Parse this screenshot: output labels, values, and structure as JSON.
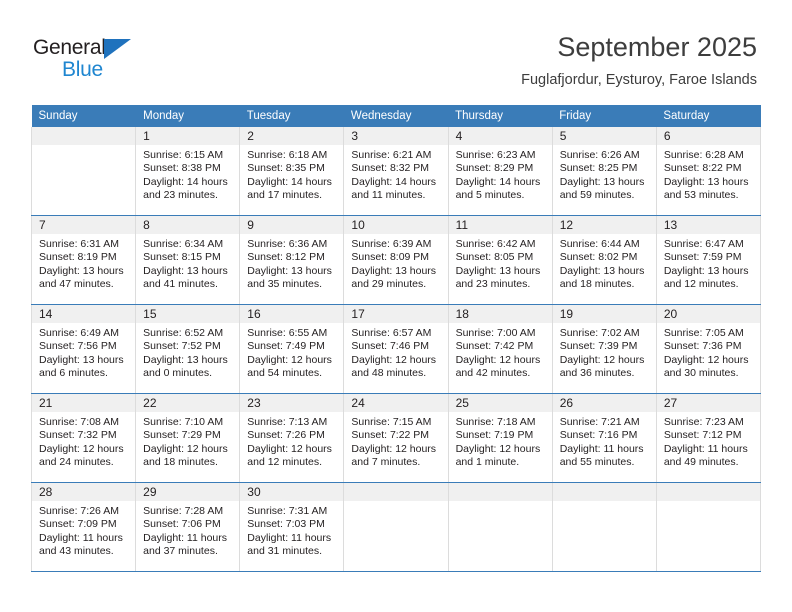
{
  "brand": {
    "name_top": "General",
    "name_bottom": "Blue",
    "accent_color": "#1f86d0",
    "triangle_color": "#1f72bd"
  },
  "header": {
    "title": "September 2025",
    "subtitle": "Fuglafjordur, Eysturoy, Faroe Islands"
  },
  "theme": {
    "header_row_bg": "#3a7cb8",
    "daynum_band_bg": "#f0f0f0",
    "cell_border": "#dcdcdc",
    "week_divider": "#3a7cb8",
    "text": "#231f20"
  },
  "weekday_headers": [
    "Sunday",
    "Monday",
    "Tuesday",
    "Wednesday",
    "Thursday",
    "Friday",
    "Saturday"
  ],
  "weeks": [
    [
      {
        "day": "",
        "sunrise": "",
        "sunset": "",
        "daylight": ""
      },
      {
        "day": "1",
        "sunrise": "Sunrise: 6:15 AM",
        "sunset": "Sunset: 8:38 PM",
        "daylight": "Daylight: 14 hours and 23 minutes."
      },
      {
        "day": "2",
        "sunrise": "Sunrise: 6:18 AM",
        "sunset": "Sunset: 8:35 PM",
        "daylight": "Daylight: 14 hours and 17 minutes."
      },
      {
        "day": "3",
        "sunrise": "Sunrise: 6:21 AM",
        "sunset": "Sunset: 8:32 PM",
        "daylight": "Daylight: 14 hours and 11 minutes."
      },
      {
        "day": "4",
        "sunrise": "Sunrise: 6:23 AM",
        "sunset": "Sunset: 8:29 PM",
        "daylight": "Daylight: 14 hours and 5 minutes."
      },
      {
        "day": "5",
        "sunrise": "Sunrise: 6:26 AM",
        "sunset": "Sunset: 8:25 PM",
        "daylight": "Daylight: 13 hours and 59 minutes."
      },
      {
        "day": "6",
        "sunrise": "Sunrise: 6:28 AM",
        "sunset": "Sunset: 8:22 PM",
        "daylight": "Daylight: 13 hours and 53 minutes."
      }
    ],
    [
      {
        "day": "7",
        "sunrise": "Sunrise: 6:31 AM",
        "sunset": "Sunset: 8:19 PM",
        "daylight": "Daylight: 13 hours and 47 minutes."
      },
      {
        "day": "8",
        "sunrise": "Sunrise: 6:34 AM",
        "sunset": "Sunset: 8:15 PM",
        "daylight": "Daylight: 13 hours and 41 minutes."
      },
      {
        "day": "9",
        "sunrise": "Sunrise: 6:36 AM",
        "sunset": "Sunset: 8:12 PM",
        "daylight": "Daylight: 13 hours and 35 minutes."
      },
      {
        "day": "10",
        "sunrise": "Sunrise: 6:39 AM",
        "sunset": "Sunset: 8:09 PM",
        "daylight": "Daylight: 13 hours and 29 minutes."
      },
      {
        "day": "11",
        "sunrise": "Sunrise: 6:42 AM",
        "sunset": "Sunset: 8:05 PM",
        "daylight": "Daylight: 13 hours and 23 minutes."
      },
      {
        "day": "12",
        "sunrise": "Sunrise: 6:44 AM",
        "sunset": "Sunset: 8:02 PM",
        "daylight": "Daylight: 13 hours and 18 minutes."
      },
      {
        "day": "13",
        "sunrise": "Sunrise: 6:47 AM",
        "sunset": "Sunset: 7:59 PM",
        "daylight": "Daylight: 13 hours and 12 minutes."
      }
    ],
    [
      {
        "day": "14",
        "sunrise": "Sunrise: 6:49 AM",
        "sunset": "Sunset: 7:56 PM",
        "daylight": "Daylight: 13 hours and 6 minutes."
      },
      {
        "day": "15",
        "sunrise": "Sunrise: 6:52 AM",
        "sunset": "Sunset: 7:52 PM",
        "daylight": "Daylight: 13 hours and 0 minutes."
      },
      {
        "day": "16",
        "sunrise": "Sunrise: 6:55 AM",
        "sunset": "Sunset: 7:49 PM",
        "daylight": "Daylight: 12 hours and 54 minutes."
      },
      {
        "day": "17",
        "sunrise": "Sunrise: 6:57 AM",
        "sunset": "Sunset: 7:46 PM",
        "daylight": "Daylight: 12 hours and 48 minutes."
      },
      {
        "day": "18",
        "sunrise": "Sunrise: 7:00 AM",
        "sunset": "Sunset: 7:42 PM",
        "daylight": "Daylight: 12 hours and 42 minutes."
      },
      {
        "day": "19",
        "sunrise": "Sunrise: 7:02 AM",
        "sunset": "Sunset: 7:39 PM",
        "daylight": "Daylight: 12 hours and 36 minutes."
      },
      {
        "day": "20",
        "sunrise": "Sunrise: 7:05 AM",
        "sunset": "Sunset: 7:36 PM",
        "daylight": "Daylight: 12 hours and 30 minutes."
      }
    ],
    [
      {
        "day": "21",
        "sunrise": "Sunrise: 7:08 AM",
        "sunset": "Sunset: 7:32 PM",
        "daylight": "Daylight: 12 hours and 24 minutes."
      },
      {
        "day": "22",
        "sunrise": "Sunrise: 7:10 AM",
        "sunset": "Sunset: 7:29 PM",
        "daylight": "Daylight: 12 hours and 18 minutes."
      },
      {
        "day": "23",
        "sunrise": "Sunrise: 7:13 AM",
        "sunset": "Sunset: 7:26 PM",
        "daylight": "Daylight: 12 hours and 12 minutes."
      },
      {
        "day": "24",
        "sunrise": "Sunrise: 7:15 AM",
        "sunset": "Sunset: 7:22 PM",
        "daylight": "Daylight: 12 hours and 7 minutes."
      },
      {
        "day": "25",
        "sunrise": "Sunrise: 7:18 AM",
        "sunset": "Sunset: 7:19 PM",
        "daylight": "Daylight: 12 hours and 1 minute."
      },
      {
        "day": "26",
        "sunrise": "Sunrise: 7:21 AM",
        "sunset": "Sunset: 7:16 PM",
        "daylight": "Daylight: 11 hours and 55 minutes."
      },
      {
        "day": "27",
        "sunrise": "Sunrise: 7:23 AM",
        "sunset": "Sunset: 7:12 PM",
        "daylight": "Daylight: 11 hours and 49 minutes."
      }
    ],
    [
      {
        "day": "28",
        "sunrise": "Sunrise: 7:26 AM",
        "sunset": "Sunset: 7:09 PM",
        "daylight": "Daylight: 11 hours and 43 minutes."
      },
      {
        "day": "29",
        "sunrise": "Sunrise: 7:28 AM",
        "sunset": "Sunset: 7:06 PM",
        "daylight": "Daylight: 11 hours and 37 minutes."
      },
      {
        "day": "30",
        "sunrise": "Sunrise: 7:31 AM",
        "sunset": "Sunset: 7:03 PM",
        "daylight": "Daylight: 11 hours and 31 minutes."
      },
      {
        "day": "",
        "sunrise": "",
        "sunset": "",
        "daylight": ""
      },
      {
        "day": "",
        "sunrise": "",
        "sunset": "",
        "daylight": ""
      },
      {
        "day": "",
        "sunrise": "",
        "sunset": "",
        "daylight": ""
      },
      {
        "day": "",
        "sunrise": "",
        "sunset": "",
        "daylight": ""
      }
    ]
  ]
}
